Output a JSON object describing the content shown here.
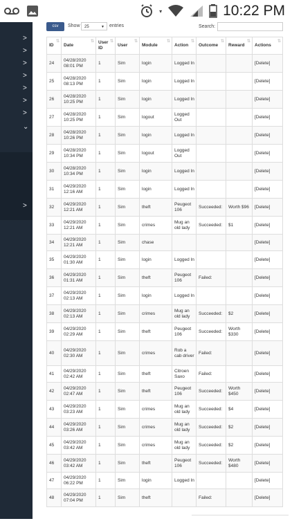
{
  "status_bar": {
    "time": "10:22 PM",
    "icons": [
      "voicemail-icon",
      "image-icon",
      "alarm-icon",
      "wifi-icon",
      "signal-icon",
      "battery-icon"
    ]
  },
  "sidebar": {
    "icons": [
      "chevron-right-icon",
      "chevron-right-icon",
      "chevron-right-icon",
      "chevron-right-icon",
      "chevron-right-icon",
      "chevron-right-icon",
      "chevron-right-icon",
      "chevron-down-icon",
      "chevron-right-icon"
    ]
  },
  "toolbar": {
    "csv_label": "csv",
    "show_label": "Show",
    "page_size": "25",
    "entries_label": "entries",
    "search_label": "Search:"
  },
  "table": {
    "headers": [
      "ID",
      "Date",
      "User ID",
      "User",
      "Module",
      "Action",
      "Outcome",
      "Reward",
      "Actions"
    ],
    "rows": [
      [
        "24",
        "04/28/2020 08:01 PM",
        "1",
        "Sim",
        "login",
        "Logged In",
        "",
        "",
        "[Delete]"
      ],
      [
        "25",
        "04/28/2020 08:13 PM",
        "1",
        "Sim",
        "login",
        "Logged In",
        "",
        "",
        "[Delete]"
      ],
      [
        "26",
        "04/28/2020 10:25 PM",
        "1",
        "Sim",
        "login",
        "Logged In",
        "",
        "",
        "[Delete]"
      ],
      [
        "27",
        "04/28/2020 10:25 PM",
        "1",
        "Sim",
        "logout",
        "Logged Out",
        "",
        "",
        "[Delete]"
      ],
      [
        "28",
        "04/28/2020 10:26 PM",
        "1",
        "Sim",
        "login",
        "Logged In",
        "",
        "",
        "[Delete]"
      ],
      [
        "29",
        "04/28/2020 10:34 PM",
        "1",
        "Sim",
        "logout",
        "Logged Out",
        "",
        "",
        "[Delete]"
      ],
      [
        "30",
        "04/28/2020 10:34 PM",
        "1",
        "Sim",
        "login",
        "Logged In",
        "",
        "",
        "[Delete]"
      ],
      [
        "31",
        "04/29/2020 12:16 AM",
        "1",
        "Sim",
        "login",
        "Logged In",
        "",
        "",
        "[Delete]"
      ],
      [
        "32",
        "04/29/2020 12:21 AM",
        "1",
        "Sim",
        "theft",
        "Peugeot 106",
        "Succeeded:",
        "Worth $96",
        "[Delete]"
      ],
      [
        "33",
        "04/29/2020 12:21 AM",
        "1",
        "Sim",
        "crimes",
        "Mug an old lady",
        "Succeeded:",
        "$1",
        "[Delete]"
      ],
      [
        "34",
        "04/29/2020 12:21 AM",
        "1",
        "Sim",
        "chase",
        "",
        "",
        "",
        "[Delete]"
      ],
      [
        "35",
        "04/29/2020 01:30 AM",
        "1",
        "Sim",
        "login",
        "Logged In",
        "",
        "",
        "[Delete]"
      ],
      [
        "36",
        "04/29/2020 01:31 AM",
        "1",
        "Sim",
        "theft",
        "Peugeot 106",
        "Failed:",
        "",
        "[Delete]"
      ],
      [
        "37",
        "04/29/2020 02:13 AM",
        "1",
        "Sim",
        "login",
        "Logged In",
        "",
        "",
        "[Delete]"
      ],
      [
        "38",
        "04/29/2020 02:13 AM",
        "1",
        "Sim",
        "crimes",
        "Mug an old lady",
        "Succeeded:",
        "$2",
        "[Delete]"
      ],
      [
        "39",
        "04/29/2020 02:29 AM",
        "1",
        "Sim",
        "theft",
        "Peugeot 106",
        "Succeeded:",
        "Worth $330",
        "[Delete]"
      ],
      [
        "40",
        "04/29/2020 02:30 AM",
        "1",
        "Sim",
        "crimes",
        "Rob a cab driver",
        "Failed:",
        "",
        "[Delete]"
      ],
      [
        "41",
        "04/29/2020 02:42 AM",
        "1",
        "Sim",
        "theft",
        "Citroen Saxo",
        "Failed:",
        "",
        "[Delete]"
      ],
      [
        "42",
        "04/29/2020 02:47 AM",
        "1",
        "Sim",
        "theft",
        "Peugeot 106",
        "Succeeded:",
        "Worth $450",
        "[Delete]"
      ],
      [
        "43",
        "04/29/2020 03:23 AM",
        "1",
        "Sim",
        "crimes",
        "Mug an old lady",
        "Succeeded:",
        "$4",
        "[Delete]"
      ],
      [
        "44",
        "04/29/2020 03:26 AM",
        "1",
        "Sim",
        "crimes",
        "Mug an old lady",
        "Succeeded:",
        "$2",
        "[Delete]"
      ],
      [
        "45",
        "04/29/2020 03:42 AM",
        "1",
        "Sim",
        "crimes",
        "Mug an old lady",
        "Succeeded:",
        "$2",
        "[Delete]"
      ],
      [
        "46",
        "04/29/2020 03:42 AM",
        "1",
        "Sim",
        "theft",
        "Peugeot 106",
        "Succeeded:",
        "Worth $480",
        "[Delete]"
      ],
      [
        "47",
        "04/29/2020 06:22 PM",
        "1",
        "Sim",
        "login",
        "Logged In",
        "",
        "",
        "[Delete]"
      ],
      [
        "48",
        "04/29/2020 07:04 PM",
        "1",
        "Sim",
        "theft",
        "",
        "Failed:",
        "",
        "[Delete]"
      ]
    ]
  }
}
